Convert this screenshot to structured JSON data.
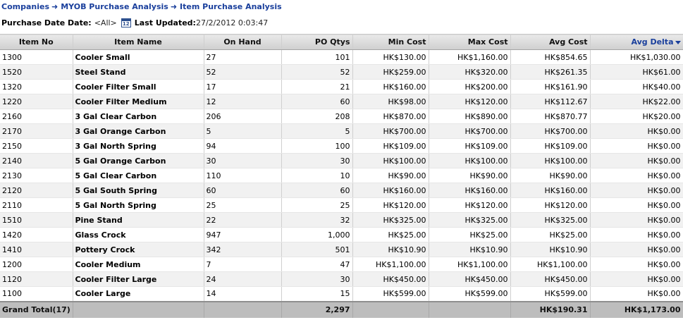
{
  "breadcrumb": {
    "items": [
      "Companies",
      "MYOB Purchase Analysis",
      "Item Purchase Analysis"
    ]
  },
  "filters": {
    "purchase_date_label": "Purchase Date Date:",
    "purchase_date_value": "<All>",
    "calendar_icon_text": "12",
    "last_updated_label": "Last Updated:",
    "last_updated_value": "27/2/2012 0:03:47"
  },
  "table": {
    "columns": [
      "Item No",
      "Item Name",
      "On Hand",
      "PO Qtys",
      "Min Cost",
      "Max Cost",
      "Avg Cost",
      "Avg Delta"
    ],
    "sorted_column": "Avg Delta",
    "rows": [
      [
        "1300",
        "Cooler Small",
        "27",
        "101",
        "HK$130.00",
        "HK$1,160.00",
        "HK$854.65",
        "HK$1,030.00"
      ],
      [
        "1520",
        "Steel Stand",
        "52",
        "52",
        "HK$259.00",
        "HK$320.00",
        "HK$261.35",
        "HK$61.00"
      ],
      [
        "1320",
        "Cooler Filter Small",
        "17",
        "21",
        "HK$160.00",
        "HK$200.00",
        "HK$161.90",
        "HK$40.00"
      ],
      [
        "1220",
        "Cooler Filter Medium",
        "12",
        "60",
        "HK$98.00",
        "HK$120.00",
        "HK$112.67",
        "HK$22.00"
      ],
      [
        "2160",
        "3 Gal Clear Carbon",
        "206",
        "208",
        "HK$870.00",
        "HK$890.00",
        "HK$870.77",
        "HK$20.00"
      ],
      [
        "2170",
        "3 Gal Orange Carbon",
        "5",
        "5",
        "HK$700.00",
        "HK$700.00",
        "HK$700.00",
        "HK$0.00"
      ],
      [
        "2150",
        "3 Gal North Spring",
        "94",
        "100",
        "HK$109.00",
        "HK$109.00",
        "HK$109.00",
        "HK$0.00"
      ],
      [
        "2140",
        "5 Gal Orange Carbon",
        "30",
        "30",
        "HK$100.00",
        "HK$100.00",
        "HK$100.00",
        "HK$0.00"
      ],
      [
        "2130",
        "5 Gal Clear Carbon",
        "110",
        "10",
        "HK$90.00",
        "HK$90.00",
        "HK$90.00",
        "HK$0.00"
      ],
      [
        "2120",
        "5 Gal South Spring",
        "60",
        "60",
        "HK$160.00",
        "HK$160.00",
        "HK$160.00",
        "HK$0.00"
      ],
      [
        "2110",
        "5 Gal North Spring",
        "25",
        "25",
        "HK$120.00",
        "HK$120.00",
        "HK$120.00",
        "HK$0.00"
      ],
      [
        "1510",
        "Pine Stand",
        "22",
        "32",
        "HK$325.00",
        "HK$325.00",
        "HK$325.00",
        "HK$0.00"
      ],
      [
        "1420",
        "Glass Crock",
        "947",
        "1,000",
        "HK$25.00",
        "HK$25.00",
        "HK$25.00",
        "HK$0.00"
      ],
      [
        "1410",
        "Pottery Crock",
        "342",
        "501",
        "HK$10.90",
        "HK$10.90",
        "HK$10.90",
        "HK$0.00"
      ],
      [
        "1200",
        "Cooler Medium",
        "7",
        "47",
        "HK$1,100.00",
        "HK$1,100.00",
        "HK$1,100.00",
        "HK$0.00"
      ],
      [
        "1120",
        "Cooler Filter Large",
        "24",
        "30",
        "HK$450.00",
        "HK$450.00",
        "HK$450.00",
        "HK$0.00"
      ],
      [
        "1100",
        "Cooler Large",
        "14",
        "15",
        "HK$599.00",
        "HK$599.00",
        "HK$599.00",
        "HK$0.00"
      ]
    ],
    "grand_total": {
      "label": "Grand Total(17)",
      "po_qtys": "2,297",
      "avg_cost": "HK$190.31",
      "avg_delta": "HK$1,173.00"
    }
  },
  "colors": {
    "link": "#1a3f9c",
    "header_bg": "#d9d9d9",
    "row_alt_bg": "#f1f1f1",
    "total_bg": "#bdbdbd"
  },
  "icons": {
    "breadcrumb_separator": "arrow-right-icon",
    "calendar": "calendar-icon",
    "sort": "sort-desc-icon"
  }
}
